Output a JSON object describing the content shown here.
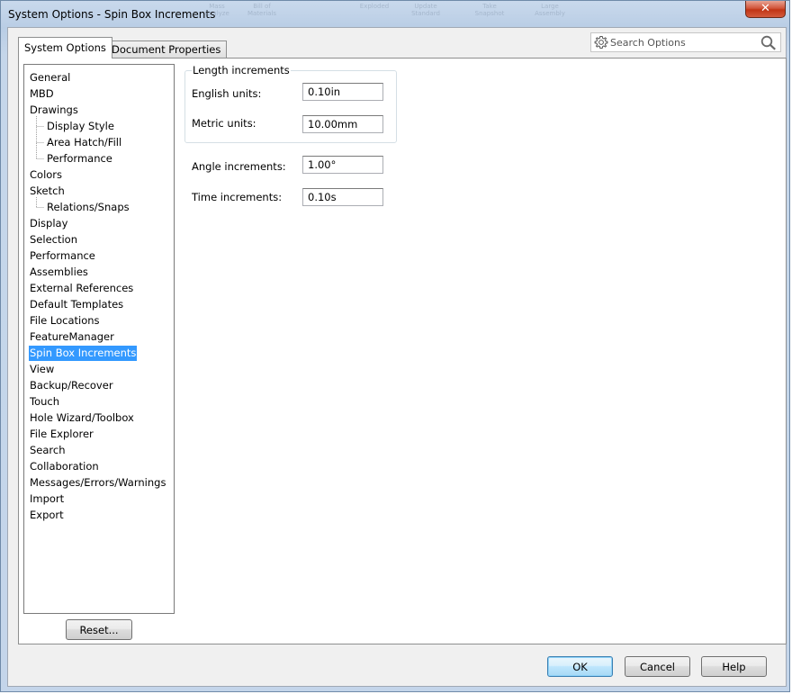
{
  "window": {
    "title": "System Options - Spin Box Increments",
    "close_glyph": "✕",
    "background_toolbar_labels": [
      "Mass Analyze",
      "Bill of Materials",
      "",
      "Exploded",
      "Update Standard",
      "Take Snapshot",
      "Large Assembly"
    ]
  },
  "tabs": [
    {
      "label": "System Options",
      "active": true
    },
    {
      "label": "Document Properties",
      "active": false
    }
  ],
  "search": {
    "placeholder": "Search Options",
    "value": "",
    "left_icon": "gear-icon",
    "right_icon": "search-icon"
  },
  "tree": {
    "items": [
      {
        "label": "General",
        "level": 0
      },
      {
        "label": "MBD",
        "level": 0
      },
      {
        "label": "Drawings",
        "level": 0
      },
      {
        "label": "Display Style",
        "level": 1
      },
      {
        "label": "Area Hatch/Fill",
        "level": 1
      },
      {
        "label": "Performance",
        "level": 1
      },
      {
        "label": "Colors",
        "level": 0
      },
      {
        "label": "Sketch",
        "level": 0
      },
      {
        "label": "Relations/Snaps",
        "level": 1
      },
      {
        "label": "Display",
        "level": 0
      },
      {
        "label": "Selection",
        "level": 0
      },
      {
        "label": "Performance",
        "level": 0
      },
      {
        "label": "Assemblies",
        "level": 0
      },
      {
        "label": "External References",
        "level": 0
      },
      {
        "label": "Default Templates",
        "level": 0
      },
      {
        "label": "File Locations",
        "level": 0
      },
      {
        "label": "FeatureManager",
        "level": 0
      },
      {
        "label": "Spin Box Increments",
        "level": 0,
        "selected": true
      },
      {
        "label": "View",
        "level": 0
      },
      {
        "label": "Backup/Recover",
        "level": 0
      },
      {
        "label": "Touch",
        "level": 0
      },
      {
        "label": "Hole Wizard/Toolbox",
        "level": 0
      },
      {
        "label": "File Explorer",
        "level": 0
      },
      {
        "label": "Search",
        "level": 0
      },
      {
        "label": "Collaboration",
        "level": 0
      },
      {
        "label": "Messages/Errors/Warnings",
        "level": 0
      },
      {
        "label": "Import",
        "level": 0
      },
      {
        "label": "Export",
        "level": 0
      }
    ],
    "selection_color": "#3399ff"
  },
  "reset_label": "Reset...",
  "length_group": {
    "legend": "Length increments",
    "english_label": "English units:",
    "english_value": "0.10in",
    "metric_label": "Metric units:",
    "metric_value": "10.00mm"
  },
  "angle": {
    "label": "Angle increments:",
    "value": "1.00°"
  },
  "time": {
    "label": "Time increments:",
    "value": "0.10s"
  },
  "footer": {
    "ok": "OK",
    "cancel": "Cancel",
    "help": "Help"
  }
}
